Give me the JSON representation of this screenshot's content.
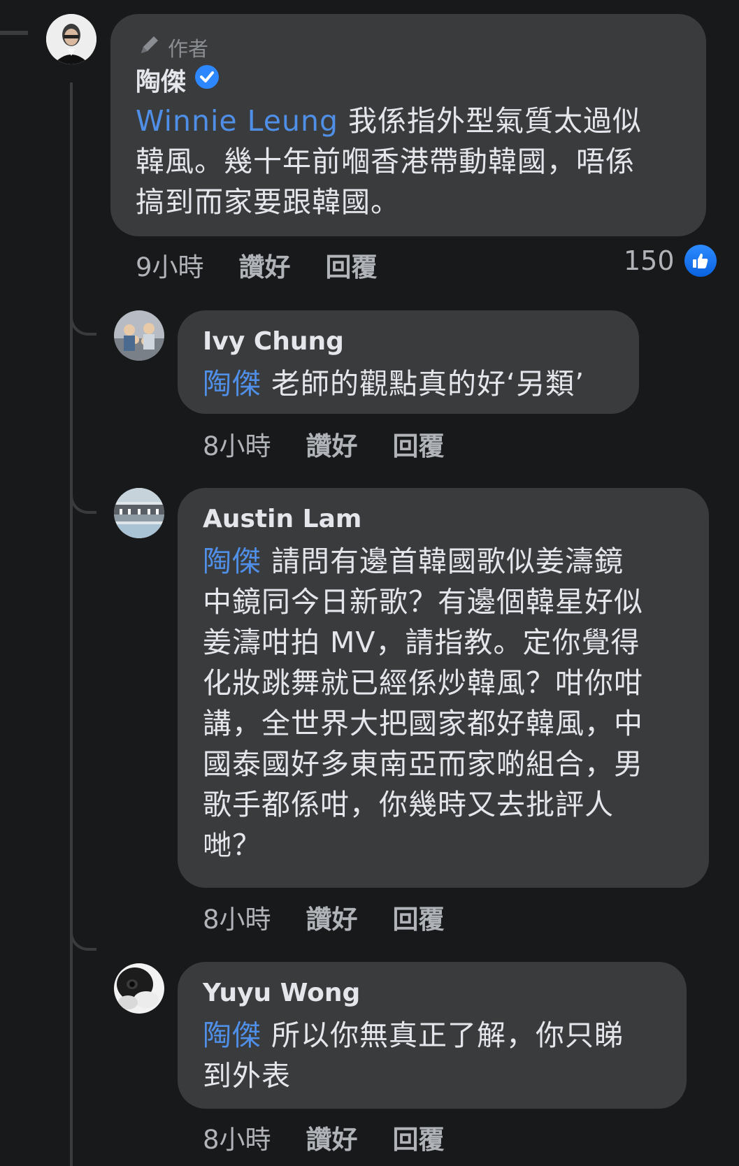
{
  "comments": [
    {
      "badge": "作者",
      "name": "陶傑",
      "verified": true,
      "mention": "Winnie Leung",
      "lines": [
        "我係指外型氣質太過似",
        "韓風。幾十年前嗰香港帶動韓國，唔係",
        "搞到而家要跟韓國。"
      ],
      "time": "9小時",
      "like_label": "讚好",
      "reply_label": "回覆",
      "likes": "150"
    },
    {
      "name": "Ivy Chung",
      "mention": "陶傑",
      "lines": [
        "老師的觀點真的好‘另類’"
      ],
      "time": "8小時",
      "like_label": "讚好",
      "reply_label": "回覆"
    },
    {
      "name": "Austin Lam",
      "mention": "陶傑",
      "lines": [
        "請問有邊首韓國歌似姜濤鏡",
        "中鏡同今日新歌？有邊個韓星好似",
        "姜濤咁拍 MV，請指教。定你覺得",
        "化妝跳舞就已經係炒韓風？咁你咁",
        "講，全世界大把國家都好韓風，中",
        "國泰國好多東南亞而家啲組合，男",
        "歌手都係咁，你幾時又去批評人",
        "哋？"
      ],
      "time": "8小時",
      "like_label": "讚好",
      "reply_label": "回覆"
    },
    {
      "name": "Yuyu Wong",
      "mention": "陶傑",
      "lines": [
        "所以你無真正了解，你只睇",
        "到外表"
      ],
      "time": "8小時",
      "like_label": "讚好",
      "reply_label": "回覆"
    }
  ],
  "icons": {
    "badge_icon": "pencil-icon",
    "verified_icon": "verified-check-icon",
    "like_reaction_icon": "thumbs-up-icon"
  },
  "colors": {
    "background": "#18191a",
    "bubble": "#3a3b3c",
    "mention": "#4f8fe8",
    "meta": "#b0b3b8"
  }
}
